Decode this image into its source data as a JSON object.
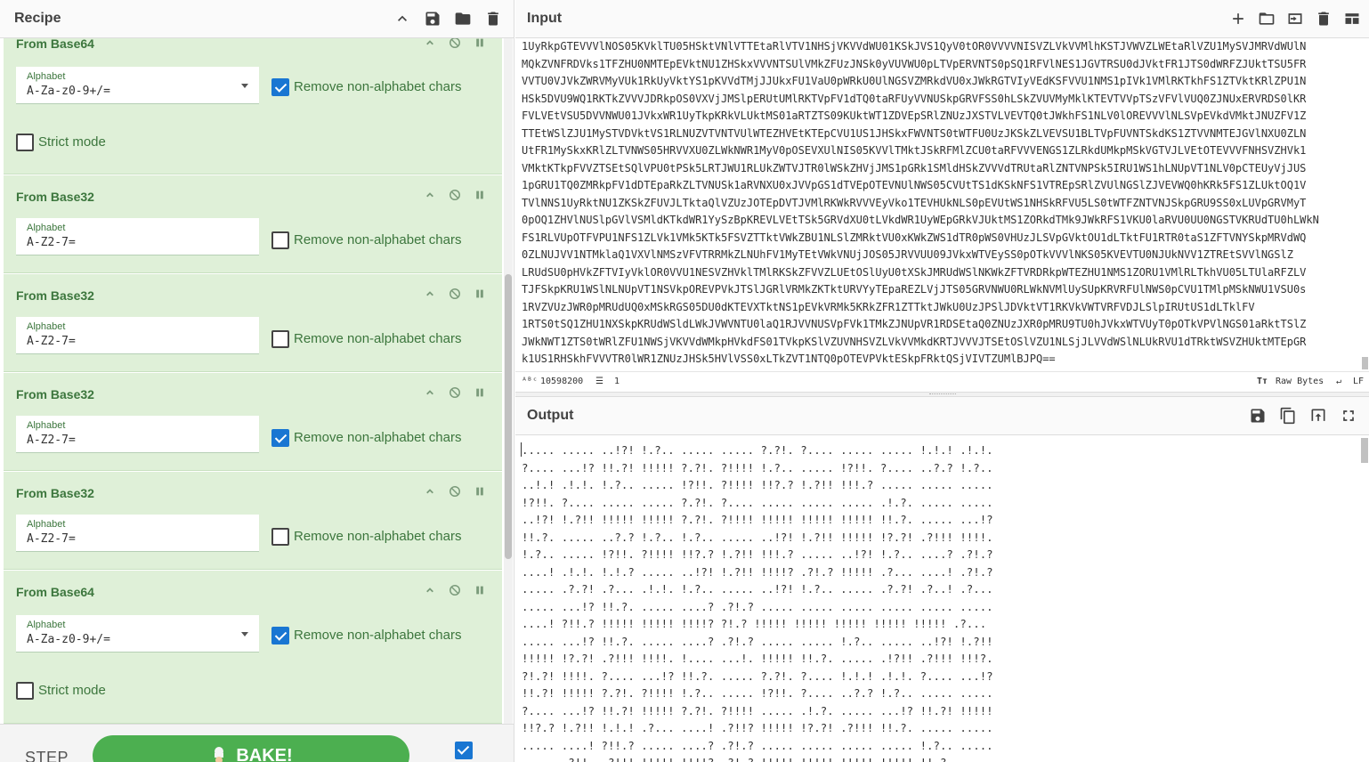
{
  "recipe": {
    "title": "Recipe",
    "operations": [
      {
        "name": "From Base64",
        "alphabet_label": "Alphabet",
        "alphabet_value": "A-Za-z0-9+/=",
        "has_dropdown": true,
        "remove_label": "Remove non-alphabet chars",
        "remove_checked": true,
        "strict_label": "Strict mode",
        "strict_checked": false
      },
      {
        "name": "From Base32",
        "alphabet_label": "Alphabet",
        "alphabet_value": "A-Z2-7=",
        "remove_label": "Remove non-alphabet chars",
        "remove_checked": false
      },
      {
        "name": "From Base32",
        "alphabet_label": "Alphabet",
        "alphabet_value": "A-Z2-7=",
        "remove_label": "Remove non-alphabet chars",
        "remove_checked": false
      },
      {
        "name": "From Base32",
        "alphabet_label": "Alphabet",
        "alphabet_value": "A-Z2-7=",
        "remove_label": "Remove non-alphabet chars",
        "remove_checked": true
      },
      {
        "name": "From Base32",
        "alphabet_label": "Alphabet",
        "alphabet_value": "A-Z2-7=",
        "remove_label": "Remove non-alphabet chars",
        "remove_checked": false
      },
      {
        "name": "From Base64",
        "alphabet_label": "Alphabet",
        "alphabet_value": "A-Za-z0-9+/=",
        "has_dropdown": true,
        "remove_label": "Remove non-alphabet chars",
        "remove_checked": true,
        "strict_label": "Strict mode",
        "strict_checked": false
      }
    ],
    "step_label": "STEP",
    "bake_label": "BAKE!",
    "autobake_checked": true
  },
  "input": {
    "title": "Input",
    "lines": [
      "1UyRkpGTEVVVlNOS05KVklTU05HSktVNlVTTEtaRlVTV1NHSjVKVVdWU01KSkJVS1QyV0tOR0VVVVNISVZLVkVVMlhKSTJVWVZLWEtaRlVZU1MySVJMRVdWUlN",
      "MQkZVNFRDVks1TFZHU0NMTEpEVktNU1ZHSkxVVVNTSUlVMkZFUzJNSk0yVUVWU0pLTVpERVNTS0pSQ1RFVlNES1JGVTRSU0dJVktFR1JTS0dWRFZJUktTSU5FR",
      "VVTU0VJVkZWRVMyVUk1RkUyVktYS1pKVVdTMjJJUkxFU1VaU0pWRkU0UlNGSVZMRkdVU0xJWkRGTVIyVEdKSFVVU1NMS1pIVk1VMlRKTkhFS1ZTVktKRlZPU1N",
      "HSk5DVU9WQ1RKTkZVVVJDRkpOS0VXVjJMSlpERUtUMlRKTVpFV1dTQ0taRFUyVVNUSkpGRVFSS0hLSkZVUVMyMklKTEVTVVpTSzVFVlVUQ0ZJNUxERVRDS0lKR",
      "FVLVEtVSU5DVVNWU01JVkxWR1UyTkpKRkVLUktMS01aRTZTS09KUktWT1ZDVEpSRlZNUzJXSTVLVEVTQ0tJWkhFS1NLV0lOREVVVlNLSVpEVkdVMktJNUZFV1Z",
      "TTEtWSlZJU1MySTVDVktVS1RLNUZVTVNTVUlWTEZHVEtKTEpCVU1US1JHSkxFWVNTS0tWTFU0UzJKSkZLVEVSU1BLTVpFUVNTSkdKS1ZTVVNMTEJGVlNXU0ZLN",
      "UtFR1MySkxKRlZLTVNWS05HRVVXU0ZLWkNWR1MyV0pOSEVXUlNIS05KVVlTMktJSkRFMlZCU0taRFVVVENGS1ZLRkdUMkpMSkVGTVJLVEtOTEVVVFNHSVZHVk1",
      "VMktKTkpFVVZTSEtSQlVPU0tPSk5LRTJWU1RLUkZWTVJTR0lWSkZHVjJMS1pGRk1SMldHSkZVVVdTRUtaRlZNTVNPSk5IRU1WS1hLNUpVT1NLV0pCTEUyVjJUS",
      "1pGRU1TQ0ZMRkpFV1dDTEpaRkZLTVNUSk1aRVNXU0xJVVpGS1dTVEpOTEVNUlNWS05CVUtTS1dKSkNFS1VTREpSRlZVUlNGSlZJVEVWQ0hKRk5FS1ZLUktOQ1V",
      "TVlNNS1UyRktNU1ZKSkZFUVJLTktaQlVZUzJOTEpDVTJVMlRKWkRVVVEyVko1TEVHUkNLS0pEVUtWS1NHSkRFVU5LS0tWTFZNTVNJSkpGRU9SS0xLUVpGRVMyT",
      "0pOQ1ZHVlNUSlpGVlVSMldKTkdWR1YySzBpKREVLVEtTSk5GRVdXU0tLVkdWR1UyWEpGRkVJUktMS1ZORkdTMk9JWkRFS1VKU0laRVU0UU0NGSTVKRUdTU0hLWkN",
      "FS1RLVUpOTFVPU1NFS1ZLVk1VMk5KTk5FSVZTTktVWkZBU1NLSlZMRktVU0xKWkZWS1dTR0pWS0VHUzJLSVpGVktOU1dLTktFU1RTR0taS1ZFTVNYSkpMRVdWQ",
      "0ZLNUJVV1NTMklaQ1VXVlNMSzVFVTRRMkZLNUhFV1MyTEtVWkVNUjJOS05JRVVUU09JVkxWTVEySS0pOTkVVVlNKS05KVEVTU0NJUkNVV1ZTREtSVVlNGSlZ",
      "LRUdSU0pHVkZFTVIyVklOR0VVU1NESVZHVklTMlRKSkZFVVZLUEtOSlUyU0tXSkJMRUdWSlNKWkZFTVRDRkpWTEZHU1NMS1ZORU1VMlRLTkhVU05LTUlaRFZLV",
      "TJFSkpKRU1WSlNLNUpVT1NSVkpOREVPVkJTSlJGRlVRMkZKTktURVYyTEpaREZLVjJTS05GRVNWU0RLWkNVMlUySUpKRVRFUlNWS0pCVU1TMlpMSkNWU1VSU0s",
      "1RVZVUzJWR0pMRUdUQ0xMSkRGS05DU0dKTEVXTktNS1pEVkVRMk5KRkZFR1ZTTktJWkU0UzJPSlJDVktVT1RKVkVWTVRFVDJLSlpIRUtUS1dLTklFV",
      "1RTS0tSQ1ZHU1NXSkpKRUdWSldLWkJVWVNTU0laQ1RJVVNUSVpFVk1TMkZJNUpVR1RDSEtaQ0ZNUzJXR0pMRU9TU0hJVkxWTVUyT0pOTkVPVlNGS01aRktTSlZ",
      "JWkNWT1ZTS0tWRlZFU1NWSjVKVVdWMkpHVkdFS01TVkpKSlVZUVNHSVZLVkVVMkdKRTJVVVJTSEtOSlVZU1NLSjJLVVdWSlNLUkRVU1dTRktWSVZHUktMTEpGR",
      "k1US1RHSkhFVVVTR0lWR1ZNUzJHSk5HVlVSS0xLTkZVT1NTQ0pOTEVPVktESkpFRktQSjVIVTZUMlBJPQ=="
    ],
    "char_count": "10598200",
    "line_count": "1",
    "encoding": "Raw Bytes",
    "eol": "LF"
  },
  "output": {
    "title": "Output",
    "lines": [
      "..... ..... ..!?! !.?.. ..... ..... ?.?!. ?.... ..... ..... !.!.! .!.!.",
      "?.... ...!? !!.?! !!!!! ?.?!. ?!!!! !.?.. ..... !?!!. ?.... ..?.? !.?..",
      "..!.! .!.!. !.?.. ..... !?!!. ?!!!! !!?.? !.?!! !!!.? ..... ..... .....",
      "!?!!. ?.... ..... ..... ?.?!. ?.... ..... ..... ..... .!.?. ..... .....",
      "..!?! !.?!! !!!!! !!!!! ?.?!. ?!!!! !!!!! !!!!! !!!!! !!.?. ..... ...!?",
      "!!.?. ..... ..?.? !.?.. !.?.. ..... ..!?! !.?!! !!!!! !?.?! .?!!! !!!!.",
      "!.?.. ..... !?!!. ?!!!! !!?.? !.?!! !!!.? ..... ..!?! !.?.. ....? .?!.?",
      "....! .!.!. !.!.? ..... ..!?! !.?!! !!!!? .?!.? !!!!! .?... ....! .?!.?",
      "..... .?.?! .?... .!.!. !.?.. ..... ..!?! !.?.. ..... .?.?! .?..! .?...",
      "..... ...!? !!.?. ..... ....? .?!.? ..... ..... ..... ..... ..... .....",
      "....! ?!!.? !!!!! !!!!! !!!!? ?!.? !!!!! !!!!! !!!!! !!!!! !!!!! .?...",
      "..... ...!? !!.?. ..... ....? .?!.? ..... ..... !.?.. ..... ..!?! !.?!!",
      "!!!!! !?.?! .?!!! !!!!. !.... ...!. !!!!! !!.?. ..... .!?!! .?!!! !!!?.",
      "?!.?! !!!!. ?.... ...!? !!.?. ..... ?.?!. ?.... !.!.! .!.!. ?.... ...!?",
      "!!.?! !!!!! ?.?!. ?!!!! !.?.. ..... !?!!. ?.... ..?.? !.?.. ..... .....",
      "?.... ...!? !!.?! !!!!! ?.?!. ?!!!! ..... .!.?. ..... ...!? !!.?! !!!!!",
      "!!?.? !.?!! !.!.! .?... ....! .?!!? !!!!! !?.?! .?!!! !!.?. ..... .....",
      "..... ....! ?!!.? ..... ....? .?!.? ..... ..... ..... ..... !.?.. .....",
      "..... .?!!. .?!!! !!!!! !!!!? .?!.? !!!!! !!!!! !!!!! !!!!! !!.?. ....."
    ]
  }
}
